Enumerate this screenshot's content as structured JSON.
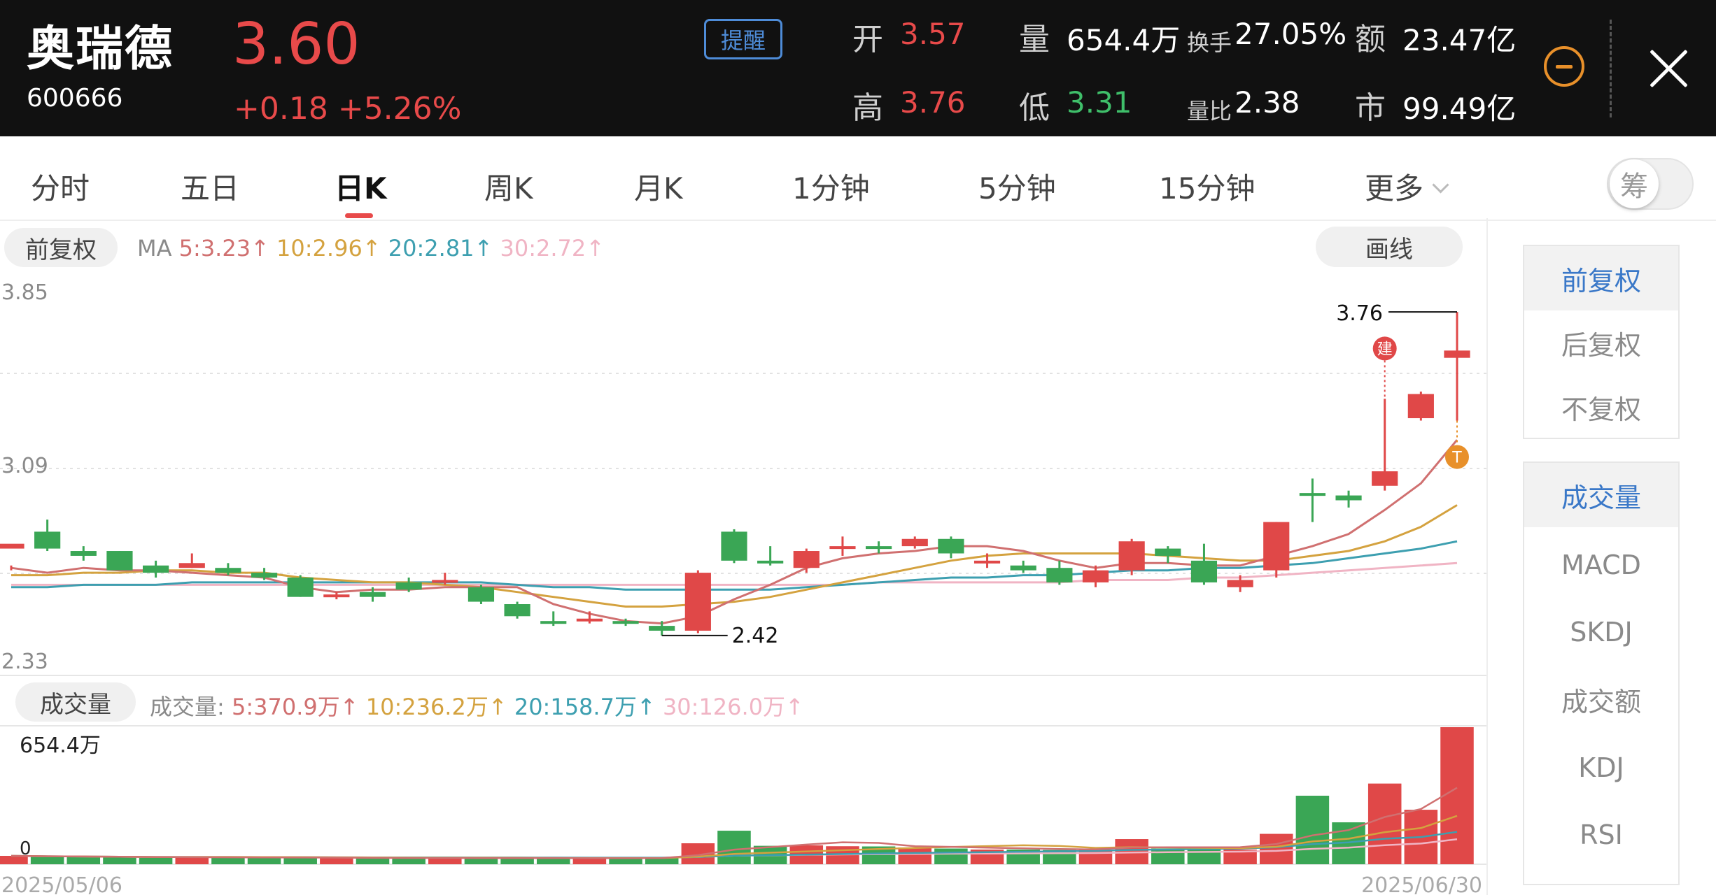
{
  "header": {
    "name": "奥瑞德",
    "code": "600666",
    "price": "3.60",
    "change": "+0.18  +5.26%",
    "alert_label": "提醒",
    "quotes": {
      "open_label": "开",
      "open": "3.57",
      "high_label": "高",
      "high": "3.76",
      "volume_label": "量",
      "volume": "654.4万",
      "low_label": "低",
      "low": "3.31",
      "turnover_label": "换手",
      "turnover": "27.05%",
      "vol_ratio_label": "量比",
      "vol_ratio": "2.38",
      "amount_label": "额",
      "amount": "23.47亿",
      "mktcap_label": "市",
      "mktcap": "99.49亿"
    },
    "icons": {
      "collapse": "minus-circle-icon",
      "close": "close-icon"
    }
  },
  "tabs": [
    "分时",
    "五日",
    "日K",
    "周K",
    "月K",
    "1分钟",
    "5分钟",
    "15分钟",
    "更多"
  ],
  "active_tab": "日K",
  "chips_toggle_label": "筹",
  "chart": {
    "adjust_label": "前复权",
    "draw_label": "画线",
    "ma": {
      "prefix": "MA",
      "ma5": "5:3.23↑",
      "ma10": "10:2.96↑",
      "ma20": "20:2.81↑",
      "ma30": "30:2.72↑"
    },
    "volume_label": "成交量",
    "vol_ma": {
      "prefix": "成交量:",
      "ma5": "5:370.9万↑",
      "ma10": "10:236.2万↑",
      "ma20": "20:158.7万↑",
      "ma30": "30:126.0万↑"
    },
    "price_axis": [
      "3.85",
      "3.09",
      "2.33"
    ],
    "vol_axis": [
      "654.4万",
      "0"
    ],
    "date_start": "2025/05/06",
    "date_end": "2025/06/30",
    "max_label": "3.76",
    "min_label": "2.42",
    "marker_buy": "建",
    "marker_t": "T"
  },
  "colors": {
    "up": "#e04848",
    "down": "#3aa655",
    "ma5": "#d07070",
    "ma10": "#d4a23f",
    "ma20": "#3d9fb0",
    "ma30": "#f0b4c4"
  },
  "sidebar": {
    "adjust": [
      "前复权",
      "后复权",
      "不复权"
    ],
    "adjust_active": 0,
    "indicators": [
      "成交量",
      "MACD",
      "SKDJ",
      "成交额",
      "KDJ",
      "RSI"
    ],
    "indicators_active": 0
  },
  "chart_data": {
    "type": "candlestick",
    "xlabel_start": "2025/05/06",
    "xlabel_end": "2025/06/30",
    "ylim": [
      2.33,
      3.85
    ],
    "candles": [
      [
        2.78,
        2.8,
        2.71,
        2.69
      ],
      [
        2.85,
        2.78,
        2.9,
        2.77
      ],
      [
        2.77,
        2.75,
        2.79,
        2.73
      ],
      [
        2.77,
        2.69,
        2.77,
        2.69
      ],
      [
        2.71,
        2.68,
        2.73,
        2.66
      ],
      [
        2.7,
        2.72,
        2.76,
        2.7
      ],
      [
        2.7,
        2.68,
        2.72,
        2.67
      ],
      [
        2.68,
        2.66,
        2.7,
        2.65
      ],
      [
        2.66,
        2.58,
        2.67,
        2.58
      ],
      [
        2.58,
        2.59,
        2.6,
        2.57
      ],
      [
        2.6,
        2.58,
        2.62,
        2.56
      ],
      [
        2.64,
        2.61,
        2.66,
        2.6
      ],
      [
        2.64,
        2.65,
        2.68,
        2.63
      ],
      [
        2.62,
        2.56,
        2.63,
        2.55
      ],
      [
        2.55,
        2.5,
        2.56,
        2.49
      ],
      [
        2.48,
        2.47,
        2.52,
        2.46
      ],
      [
        2.48,
        2.49,
        2.52,
        2.47
      ],
      [
        2.48,
        2.47,
        2.49,
        2.46
      ],
      [
        2.46,
        2.44,
        2.48,
        2.42
      ],
      [
        2.44,
        2.68,
        2.69,
        2.43
      ],
      [
        2.85,
        2.73,
        2.86,
        2.72
      ],
      [
        2.73,
        2.72,
        2.79,
        2.71
      ],
      [
        2.7,
        2.77,
        2.78,
        2.68
      ],
      [
        2.78,
        2.79,
        2.83,
        2.75
      ],
      [
        2.79,
        2.78,
        2.81,
        2.76
      ],
      [
        2.79,
        2.82,
        2.83,
        2.78
      ],
      [
        2.82,
        2.76,
        2.83,
        2.74
      ],
      [
        2.72,
        2.73,
        2.76,
        2.7
      ],
      [
        2.71,
        2.69,
        2.73,
        2.68
      ],
      [
        2.7,
        2.64,
        2.73,
        2.63
      ],
      [
        2.64,
        2.69,
        2.71,
        2.62
      ],
      [
        2.69,
        2.81,
        2.82,
        2.67
      ],
      [
        2.78,
        2.75,
        2.79,
        2.72
      ],
      [
        2.73,
        2.64,
        2.8,
        2.63
      ],
      [
        2.62,
        2.65,
        2.67,
        2.6
      ],
      [
        2.69,
        2.89,
        2.89,
        2.66
      ],
      [
        3.01,
        3.0,
        3.07,
        2.89
      ],
      [
        3.0,
        2.98,
        3.02,
        2.95
      ],
      [
        3.04,
        3.1,
        3.4,
        3.02
      ],
      [
        3.32,
        3.42,
        3.43,
        3.31
      ],
      [
        3.57,
        3.6,
        3.76,
        3.31
      ]
    ],
    "volume_wan": [
      40,
      36,
      35,
      32,
      31,
      35,
      33,
      31,
      30,
      29,
      29,
      30,
      30,
      29,
      28,
      28,
      28,
      30,
      31,
      100,
      160,
      88,
      90,
      86,
      85,
      80,
      75,
      70,
      70,
      68,
      70,
      120,
      75,
      72,
      70,
      145,
      327,
      200,
      385,
      260,
      654
    ],
    "ma5": [
      2.7,
      2.68,
      2.7,
      2.69,
      2.69,
      2.68,
      2.67,
      2.66,
      2.62,
      2.6,
      2.61,
      2.61,
      2.62,
      2.62,
      2.62,
      2.55,
      2.51,
      2.48,
      2.47,
      2.5,
      2.57,
      2.63,
      2.7,
      2.74,
      2.76,
      2.77,
      2.79,
      2.79,
      2.77,
      2.73,
      2.7,
      2.72,
      2.72,
      2.71,
      2.71,
      2.75,
      2.79,
      2.84,
      2.94,
      3.05,
      3.23
    ],
    "ma10": [
      2.67,
      2.67,
      2.68,
      2.68,
      2.69,
      2.69,
      2.68,
      2.68,
      2.66,
      2.65,
      2.64,
      2.64,
      2.63,
      2.62,
      2.6,
      2.58,
      2.56,
      2.54,
      2.54,
      2.55,
      2.56,
      2.58,
      2.61,
      2.64,
      2.67,
      2.7,
      2.73,
      2.75,
      2.76,
      2.76,
      2.76,
      2.76,
      2.75,
      2.74,
      2.73,
      2.73,
      2.75,
      2.77,
      2.81,
      2.87,
      2.96
    ],
    "ma20": [
      2.62,
      2.62,
      2.63,
      2.63,
      2.63,
      2.64,
      2.64,
      2.64,
      2.64,
      2.64,
      2.64,
      2.64,
      2.64,
      2.64,
      2.63,
      2.62,
      2.62,
      2.61,
      2.61,
      2.61,
      2.61,
      2.61,
      2.62,
      2.63,
      2.64,
      2.65,
      2.66,
      2.66,
      2.67,
      2.67,
      2.68,
      2.69,
      2.69,
      2.7,
      2.7,
      2.71,
      2.72,
      2.74,
      2.76,
      2.78,
      2.81
    ],
    "ma30": [
      2.63,
      2.63,
      2.63,
      2.63,
      2.63,
      2.63,
      2.63,
      2.63,
      2.63,
      2.63,
      2.63,
      2.63,
      2.63,
      2.63,
      2.63,
      2.63,
      2.63,
      2.63,
      2.63,
      2.63,
      2.63,
      2.63,
      2.63,
      2.63,
      2.64,
      2.64,
      2.64,
      2.64,
      2.64,
      2.64,
      2.65,
      2.65,
      2.65,
      2.66,
      2.66,
      2.67,
      2.68,
      2.69,
      2.7,
      2.71,
      2.72
    ]
  }
}
